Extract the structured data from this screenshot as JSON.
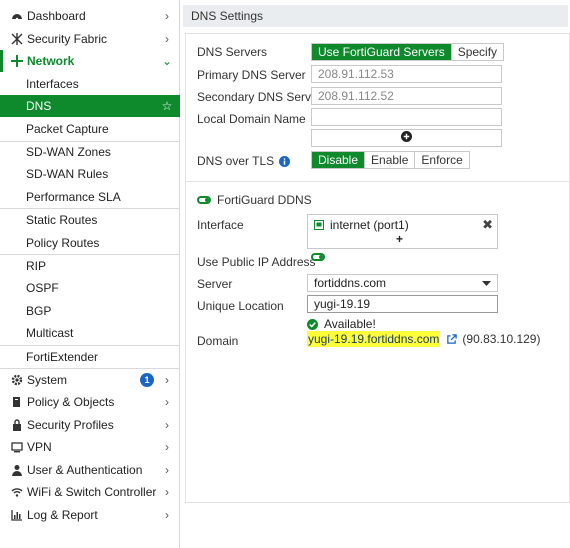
{
  "sidebar": {
    "items": [
      {
        "label": "Dashboard",
        "icon": "dashboard-icon"
      },
      {
        "label": "Security Fabric",
        "icon": "security-fabric-icon"
      },
      {
        "label": "Network",
        "icon": "network-icon"
      },
      {
        "label": "Interfaces"
      },
      {
        "label": "DNS"
      },
      {
        "label": "Packet Capture"
      },
      {
        "label": "SD-WAN Zones"
      },
      {
        "label": "SD-WAN Rules"
      },
      {
        "label": "Performance SLA"
      },
      {
        "label": "Static Routes"
      },
      {
        "label": "Policy Routes"
      },
      {
        "label": "RIP"
      },
      {
        "label": "OSPF"
      },
      {
        "label": "BGP"
      },
      {
        "label": "Multicast"
      },
      {
        "label": "FortiExtender"
      },
      {
        "label": "System",
        "icon": "gear-icon",
        "badge": "1"
      },
      {
        "label": "Policy & Objects",
        "icon": "policy-icon"
      },
      {
        "label": "Security Profiles",
        "icon": "lock-icon"
      },
      {
        "label": "VPN",
        "icon": "monitor-icon"
      },
      {
        "label": "User & Authentication",
        "icon": "user-icon"
      },
      {
        "label": "WiFi & Switch Controller",
        "icon": "wifi-icon"
      },
      {
        "label": "Log & Report",
        "icon": "chart-icon"
      }
    ]
  },
  "page": {
    "title": "DNS Settings"
  },
  "form": {
    "dns_servers": {
      "label": "DNS Servers",
      "options": [
        "Use FortiGuard Servers",
        "Specify"
      ],
      "selected": "Use FortiGuard Servers"
    },
    "primary": {
      "label": "Primary DNS Server",
      "value": "208.91.112.53"
    },
    "secondary": {
      "label": "Secondary DNS Server",
      "value": "208.91.112.52"
    },
    "local_domain": {
      "label": "Local Domain Name",
      "value": ""
    },
    "dns_over_tls": {
      "label": "DNS over TLS",
      "options": [
        "Disable",
        "Enable",
        "Enforce"
      ],
      "selected": "Disable"
    },
    "ddns": {
      "label": "FortiGuard DDNS",
      "enabled": true
    },
    "interface": {
      "label": "Interface",
      "value": "internet (port1)",
      "add": "+"
    },
    "use_public_ip": {
      "label": "Use Public IP Address",
      "enabled": true
    },
    "server": {
      "label": "Server",
      "value": "fortiddns.com"
    },
    "unique_location": {
      "label": "Unique Location",
      "value": "yugi-19.19"
    },
    "available": "Available!",
    "domain": {
      "label": "Domain",
      "value": "yugi-19.19.fortiddns.com",
      "ip": "(90.83.10.129)"
    }
  },
  "colors": {
    "accent": "#0e8a2d",
    "highlight": "#ffff3a",
    "badge": "#1a66c0"
  }
}
